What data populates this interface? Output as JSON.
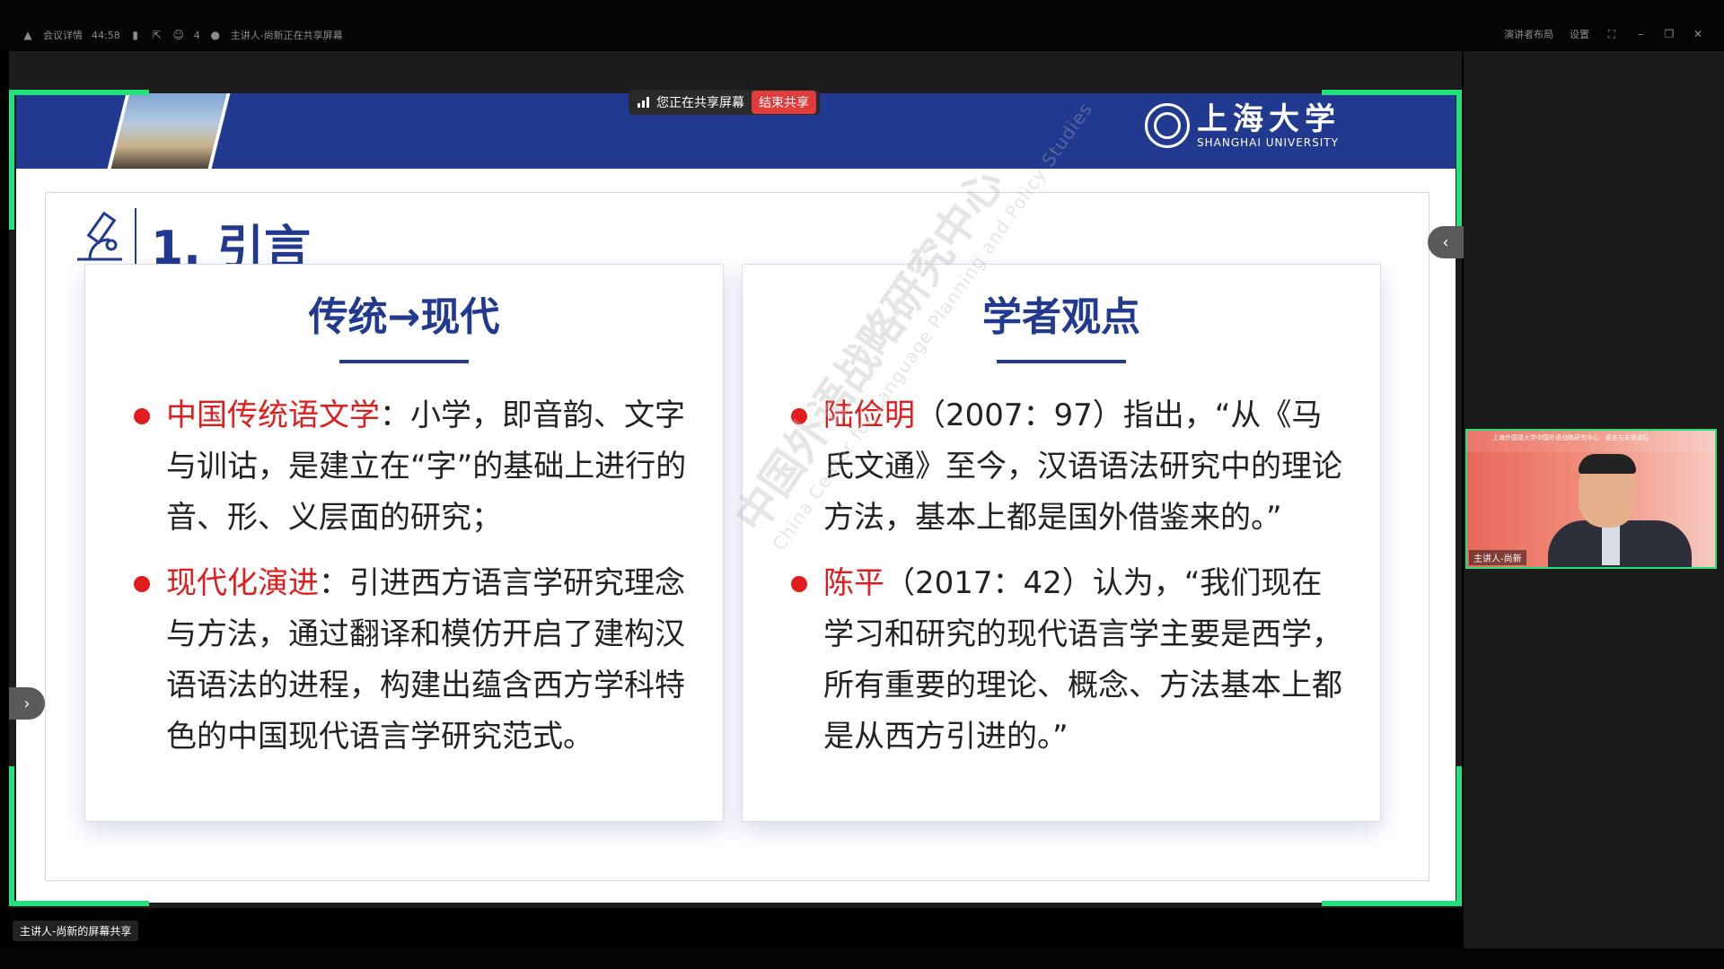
{
  "toolbar": {
    "meeting_info": "会议详情",
    "timer": "44:58",
    "participants": "4",
    "sharing_status": "主讲人-尚新正在共享屏幕",
    "presenter_layout": "演讲者布局",
    "settings": "设置"
  },
  "share_bar": {
    "status": "您正在共享屏幕",
    "stop_label": "结束共享"
  },
  "slide": {
    "logo_cn": "上海大学",
    "logo_en": "SHANGHAI UNIVERSITY",
    "section_title": "1. 引言",
    "left_card": {
      "title": "传统→现代",
      "bullets": [
        {
          "key": "中国传统语文学",
          "text": "：小学，即音韵、文字与训诂，是建立在“字”的基础上进行的音、形、义层面的研究；"
        },
        {
          "key": "现代化演进",
          "text": "：引进西方语言学研究理念与方法，通过翻译和模仿开启了建构汉语语法的进程，构建出蕴含西方学科特色的中国现代语言学研究范式。"
        }
      ]
    },
    "right_card": {
      "title": "学者观点",
      "bullets": [
        {
          "key": "陆俭明",
          "text": "（2007：97）指出，“从《马氏文通》至今，汉语语法研究中的理论方法，基本上都是国外借鉴来的。”"
        },
        {
          "key": "陈平",
          "text": "（2017：42）认为，“我们现在学习和研究的现代语言学主要是西学，所有重要的理论、概念、方法基本上都是从西方引进的。”"
        }
      ]
    },
    "watermark_cn": "中国外语战略研究中心",
    "watermark_en": "China Center for Language Planning and Policy Studies"
  },
  "video": {
    "banner": "上海外国语大学中国外语战略研究中心 · 语言与未来讲坛",
    "label": "主讲人-尚新"
  },
  "bottom": {
    "share_label": "主讲人-尚新的屏幕共享"
  },
  "colors": {
    "accent_blue": "#213a8f",
    "highlight_red": "#e01c1c",
    "frame_green": "#22e07a"
  }
}
